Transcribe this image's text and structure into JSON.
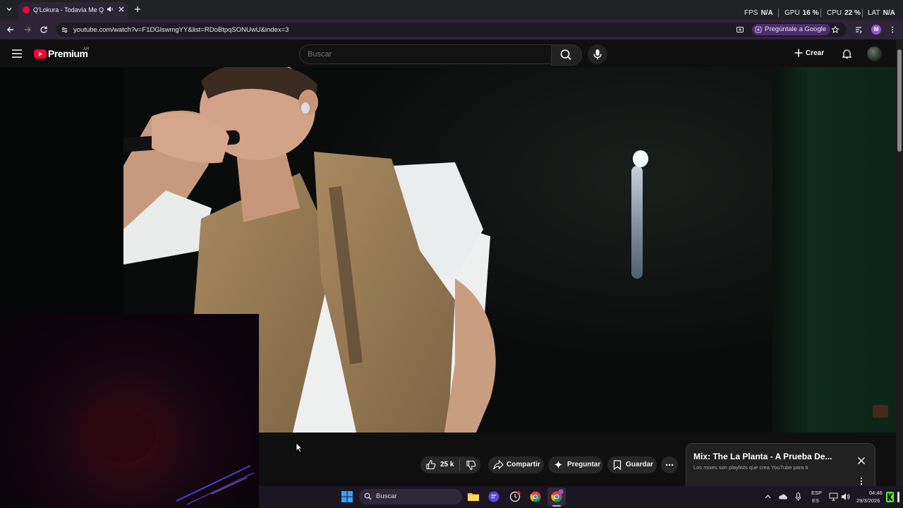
{
  "browser": {
    "tab_title": "Q'Lokura - Todavía Me Quie",
    "url": "youtube.com/watch?v=F1DGlswmgYY&list=RDoBtpqSONUwU&index=3",
    "ask_google_label": "Pregúntale a Google",
    "profile_initial": "M"
  },
  "perf_overlay": {
    "fps_label": "FPS",
    "fps_value": "N/A",
    "gpu_label": "GPU",
    "gpu_value": "16 %",
    "cpu_label": "CPU",
    "cpu_value": "22 %",
    "lat_label": "LAT",
    "lat_value": "N/A"
  },
  "youtube": {
    "logo_text": "Premium",
    "country_code": "AR",
    "search_placeholder": "Buscar",
    "create_label": "Crear"
  },
  "actions": {
    "like_count": "25 k",
    "share_label": "Compartir",
    "ask_label": "Preguntar",
    "save_label": "Guardar"
  },
  "mix_card": {
    "title": "Mix: The La Planta - A Prueba De...",
    "subtitle": "Los mixes son playlists que crea YouTube para ti"
  },
  "taskbar": {
    "search_label": "Buscar",
    "lang_line1": "ESP",
    "lang_line2": "ES",
    "time": "04:46",
    "date": "29/3/2026"
  },
  "colors": {
    "youtube_red": "#ff0033",
    "browser_accent": "#2d2438",
    "taskbar_bg": "#1c1623"
  }
}
